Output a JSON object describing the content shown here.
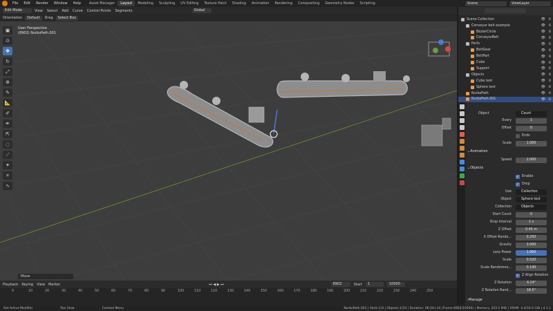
{
  "topbar": {
    "menus": [
      "File",
      "Edit",
      "Render",
      "Window",
      "Help"
    ],
    "workspaces": [
      "Asset Manager",
      "Layout",
      "Modeling",
      "Sculpting",
      "UV Editing",
      "Texture Paint",
      "Shading",
      "Animation",
      "Rendering",
      "Compositing",
      "Geometry Nodes",
      "Scripting"
    ],
    "active_workspace": "Layout",
    "scene": "Scene",
    "view_layer": "ViewLayer"
  },
  "viewport_header": {
    "mode": "Edit Mode",
    "menus": [
      "View",
      "Select",
      "Add",
      "Curve",
      "Control Points",
      "Segments"
    ],
    "transform": "Global"
  },
  "tool_header": {
    "orientation_label": "Orientation",
    "orientation_value": "Default",
    "drag_label": "Drag",
    "drag_value": "Select Box"
  },
  "viewport": {
    "perspective": "User Perspective",
    "object": "(6902) NurbsPath.001",
    "last_op": "Move"
  },
  "timeline": {
    "menus": [
      "Playback",
      "Keying",
      "View",
      "Marker"
    ],
    "current_frame": "6902",
    "start_label": "Start",
    "start": "1",
    "end": "10000",
    "ticks": [
      "0",
      "10",
      "20",
      "30",
      "40",
      "50",
      "60",
      "70",
      "80",
      "90",
      "100",
      "110",
      "120",
      "130",
      "140",
      "150",
      "160",
      "170",
      "180",
      "190",
      "200",
      "210",
      "220",
      "230",
      "240",
      "250"
    ]
  },
  "statusbar": {
    "left": [
      "Set Active Modifier",
      "Pan View",
      "Context Menu"
    ],
    "right": "NurbsPath.001 | Verts:1/4 | Objects:1/10 | Duration: 06:54+14 (Frame 6902/10000) | Memory: 203.5 MiB | VRAM: 4.4/16.0 GiB | 4.1.1"
  },
  "outliner": {
    "search_placeholder": "",
    "rows": [
      {
        "label": "Scene Collection",
        "indent": 0,
        "color": "#bbbbbb",
        "selected": false
      },
      {
        "label": "Conveyor belt example",
        "indent": 1,
        "color": "#bbbbbb",
        "selected": false
      },
      {
        "label": "BézierCircle",
        "indent": 2,
        "color": "#e89b4f",
        "selected": false
      },
      {
        "label": "ConveyorBelt",
        "indent": 2,
        "color": "#e89b4f",
        "selected": false
      },
      {
        "label": "Parts",
        "indent": 1,
        "color": "#bbbbbb",
        "selected": false
      },
      {
        "label": "BeltGear",
        "indent": 2,
        "color": "#e89b4f",
        "selected": false
      },
      {
        "label": "BeltPart",
        "indent": 2,
        "color": "#e89b4f",
        "selected": false
      },
      {
        "label": "Cube",
        "indent": 2,
        "color": "#e89b4f",
        "selected": false
      },
      {
        "label": "Support",
        "indent": 2,
        "color": "#e89b4f",
        "selected": false
      },
      {
        "label": "Objects",
        "indent": 1,
        "color": "#bbbbbb",
        "selected": false
      },
      {
        "label": "Cube test",
        "indent": 2,
        "color": "#e89b4f",
        "selected": false
      },
      {
        "label": "Sphere test",
        "indent": 2,
        "color": "#e89b4f",
        "selected": false
      },
      {
        "label": "NurbsPath",
        "indent": 1,
        "color": "#e89b4f",
        "selected": false
      },
      {
        "label": "NurbsPath.001",
        "indent": 1,
        "color": "#e89b4f",
        "selected": true
      }
    ]
  },
  "properties": {
    "object_label": "Object",
    "object_value": "Count",
    "every_label": "Every",
    "every_value": "1",
    "offset_label": "Offset",
    "offset_value": "0",
    "ends_label": "Ends",
    "scale_label": "Scale",
    "scale_value": "1.000",
    "animation_section": "Animation",
    "speed_label": "Speed",
    "speed_value": "2.000",
    "objects_section": "Objects",
    "enable_label": "Enable",
    "drop_label": "Drop",
    "use_label": "Use",
    "use_value": "Collection",
    "object2_label": "Object",
    "object2_value": "Sphere test",
    "collection_label": "Collection",
    "collection_value": "Objects",
    "start_count_label": "Start Count",
    "start_count_value": "0",
    "drop_interval_label": "Drop Interval",
    "drop_interval_value": "1 s",
    "z_offset_label": "Z Offset",
    "z_offset_value": "0.45 m",
    "x_offset_label": "X Offset Rando...",
    "x_offset_value": "0.250",
    "gravity_label": "Gravity",
    "gravity_value": "3.000",
    "lerp_label": "Lerp Power",
    "lerp_value": "1.000",
    "scale2_label": "Scale",
    "scale2_value": "0.520",
    "scale_rand_label": "Scale Randomne...",
    "scale_rand_value": "0.140",
    "z_align_label": "Z Align Rotation",
    "z_rot_label": "Z Rotation",
    "z_rot_value": "4.14°",
    "z_rot_rand_label": "Z Rotation Rand...",
    "z_rot_rand_value": "16.5°",
    "manage_section": "Manage"
  }
}
